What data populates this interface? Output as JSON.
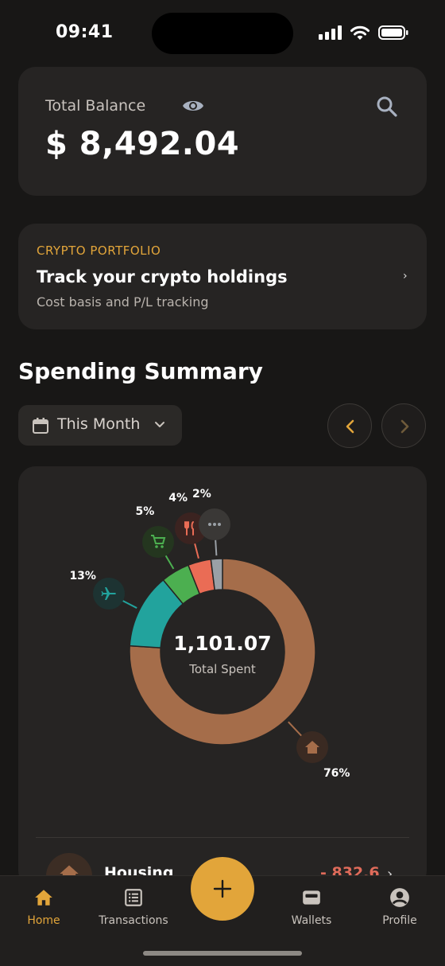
{
  "status_bar": {
    "time": "09:41"
  },
  "balance": {
    "label": "Total Balance",
    "value": "$ 8,492.04"
  },
  "crypto": {
    "kicker": "CRYPTO PORTFOLIO",
    "title": "Track your crypto holdings",
    "subtitle": "Cost basis and P/L tracking",
    "chevron": "›"
  },
  "spending": {
    "title": "Spending Summary",
    "period": "This Month",
    "total": "1,101.07",
    "total_label": "Total Spent"
  },
  "chart_data": {
    "type": "pie",
    "title": "",
    "center_value": "1,101.07",
    "center_label": "Total Spent",
    "slices": [
      {
        "category": "housing",
        "icon": "home-icon",
        "label": "76%",
        "value": 76,
        "color": "#a56d4a"
      },
      {
        "category": "travel",
        "icon": "airplane-icon",
        "label": "13%",
        "value": 13,
        "color": "#22a39d"
      },
      {
        "category": "shopping",
        "icon": "cart-icon",
        "label": "5%",
        "value": 5,
        "color": "#4caf50"
      },
      {
        "category": "dining",
        "icon": "fork-knife-icon",
        "label": "4%",
        "value": 4,
        "color": "#ea6c55"
      },
      {
        "category": "other",
        "icon": "more-icon",
        "label": "2%",
        "value": 2,
        "color": "#9aa0a6"
      }
    ]
  },
  "list": {
    "first_row": {
      "name": "Housing",
      "amount": "- 832.6",
      "chevron": "›"
    }
  },
  "nav": {
    "home": "Home",
    "transactions": "Transactions",
    "wallets": "Wallets",
    "profile": "Profile",
    "add": "+"
  },
  "colors": {
    "accent": "#e2a53a",
    "background": "#181716",
    "card": "#262423",
    "negative": "#e06b5a"
  }
}
